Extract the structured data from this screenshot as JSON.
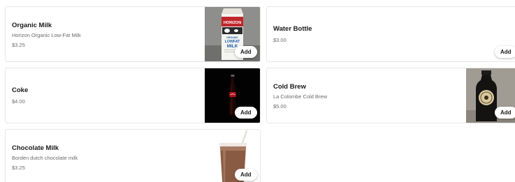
{
  "items": [
    {
      "name": "Organic Milk",
      "description": "Horizon Organic Low-Fat Milk",
      "price": "$3.25",
      "add_label": "Add",
      "image": "milk-carton-image"
    },
    {
      "name": "Water Bottle",
      "description": "",
      "price": "$3.00",
      "add_label": "Add",
      "image": ""
    },
    {
      "name": "Coke",
      "description": "",
      "price": "$4.00",
      "add_label": "Add",
      "image": "coke-bottle-image"
    },
    {
      "name": "Cold Brew",
      "description": "La Colombe Cold Brew",
      "price": "$5.00",
      "add_label": "Add",
      "image": "cold-brew-bottle-image"
    },
    {
      "name": "Chocolate Milk",
      "description": "Borden dutch chocolate milk",
      "price": "$3.25",
      "add_label": "Add",
      "image": "chocolate-milk-glass-image"
    }
  ],
  "milk_carton": {
    "brand_line": "HORIZON",
    "product_line_1": "ORGANIC",
    "product_line_2": "LOWFAT",
    "product_line_3": "MILK"
  },
  "colors": {
    "text": "#191919",
    "muted": "#6b6b6b",
    "border": "#e7e7e7"
  }
}
